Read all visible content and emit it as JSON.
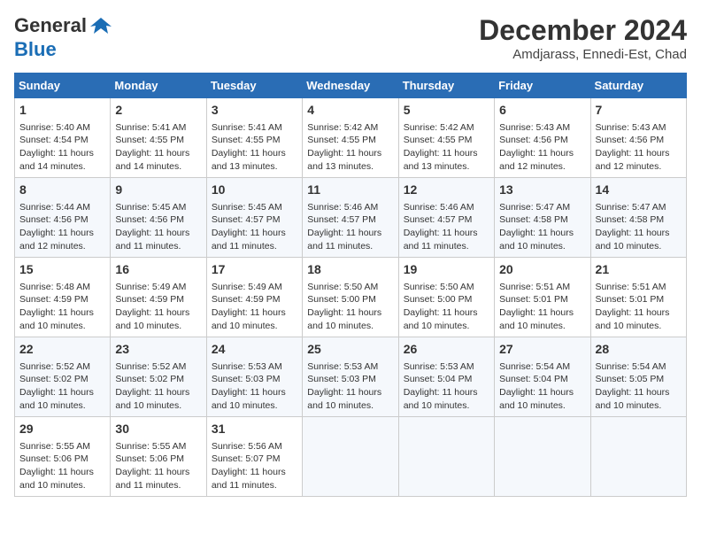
{
  "header": {
    "logo_general": "General",
    "logo_blue": "Blue",
    "month_year": "December 2024",
    "location": "Amdjarass, Ennedi-Est, Chad"
  },
  "days_of_week": [
    "Sunday",
    "Monday",
    "Tuesday",
    "Wednesday",
    "Thursday",
    "Friday",
    "Saturday"
  ],
  "weeks": [
    [
      {
        "day": 1,
        "sunrise": "5:40 AM",
        "sunset": "4:54 PM",
        "daylight": "11 hours and 14 minutes."
      },
      {
        "day": 2,
        "sunrise": "5:41 AM",
        "sunset": "4:55 PM",
        "daylight": "11 hours and 14 minutes."
      },
      {
        "day": 3,
        "sunrise": "5:41 AM",
        "sunset": "4:55 PM",
        "daylight": "11 hours and 13 minutes."
      },
      {
        "day": 4,
        "sunrise": "5:42 AM",
        "sunset": "4:55 PM",
        "daylight": "11 hours and 13 minutes."
      },
      {
        "day": 5,
        "sunrise": "5:42 AM",
        "sunset": "4:55 PM",
        "daylight": "11 hours and 13 minutes."
      },
      {
        "day": 6,
        "sunrise": "5:43 AM",
        "sunset": "4:56 PM",
        "daylight": "11 hours and 12 minutes."
      },
      {
        "day": 7,
        "sunrise": "5:43 AM",
        "sunset": "4:56 PM",
        "daylight": "11 hours and 12 minutes."
      }
    ],
    [
      {
        "day": 8,
        "sunrise": "5:44 AM",
        "sunset": "4:56 PM",
        "daylight": "11 hours and 12 minutes."
      },
      {
        "day": 9,
        "sunrise": "5:45 AM",
        "sunset": "4:56 PM",
        "daylight": "11 hours and 11 minutes."
      },
      {
        "day": 10,
        "sunrise": "5:45 AM",
        "sunset": "4:57 PM",
        "daylight": "11 hours and 11 minutes."
      },
      {
        "day": 11,
        "sunrise": "5:46 AM",
        "sunset": "4:57 PM",
        "daylight": "11 hours and 11 minutes."
      },
      {
        "day": 12,
        "sunrise": "5:46 AM",
        "sunset": "4:57 PM",
        "daylight": "11 hours and 11 minutes."
      },
      {
        "day": 13,
        "sunrise": "5:47 AM",
        "sunset": "4:58 PM",
        "daylight": "11 hours and 10 minutes."
      },
      {
        "day": 14,
        "sunrise": "5:47 AM",
        "sunset": "4:58 PM",
        "daylight": "11 hours and 10 minutes."
      }
    ],
    [
      {
        "day": 15,
        "sunrise": "5:48 AM",
        "sunset": "4:59 PM",
        "daylight": "11 hours and 10 minutes."
      },
      {
        "day": 16,
        "sunrise": "5:49 AM",
        "sunset": "4:59 PM",
        "daylight": "11 hours and 10 minutes."
      },
      {
        "day": 17,
        "sunrise": "5:49 AM",
        "sunset": "4:59 PM",
        "daylight": "11 hours and 10 minutes."
      },
      {
        "day": 18,
        "sunrise": "5:50 AM",
        "sunset": "5:00 PM",
        "daylight": "11 hours and 10 minutes."
      },
      {
        "day": 19,
        "sunrise": "5:50 AM",
        "sunset": "5:00 PM",
        "daylight": "11 hours and 10 minutes."
      },
      {
        "day": 20,
        "sunrise": "5:51 AM",
        "sunset": "5:01 PM",
        "daylight": "11 hours and 10 minutes."
      },
      {
        "day": 21,
        "sunrise": "5:51 AM",
        "sunset": "5:01 PM",
        "daylight": "11 hours and 10 minutes."
      }
    ],
    [
      {
        "day": 22,
        "sunrise": "5:52 AM",
        "sunset": "5:02 PM",
        "daylight": "11 hours and 10 minutes."
      },
      {
        "day": 23,
        "sunrise": "5:52 AM",
        "sunset": "5:02 PM",
        "daylight": "11 hours and 10 minutes."
      },
      {
        "day": 24,
        "sunrise": "5:53 AM",
        "sunset": "5:03 PM",
        "daylight": "11 hours and 10 minutes."
      },
      {
        "day": 25,
        "sunrise": "5:53 AM",
        "sunset": "5:03 PM",
        "daylight": "11 hours and 10 minutes."
      },
      {
        "day": 26,
        "sunrise": "5:53 AM",
        "sunset": "5:04 PM",
        "daylight": "11 hours and 10 minutes."
      },
      {
        "day": 27,
        "sunrise": "5:54 AM",
        "sunset": "5:04 PM",
        "daylight": "11 hours and 10 minutes."
      },
      {
        "day": 28,
        "sunrise": "5:54 AM",
        "sunset": "5:05 PM",
        "daylight": "11 hours and 10 minutes."
      }
    ],
    [
      {
        "day": 29,
        "sunrise": "5:55 AM",
        "sunset": "5:06 PM",
        "daylight": "11 hours and 10 minutes."
      },
      {
        "day": 30,
        "sunrise": "5:55 AM",
        "sunset": "5:06 PM",
        "daylight": "11 hours and 11 minutes."
      },
      {
        "day": 31,
        "sunrise": "5:56 AM",
        "sunset": "5:07 PM",
        "daylight": "11 hours and 11 minutes."
      },
      null,
      null,
      null,
      null
    ]
  ],
  "labels": {
    "sunrise": "Sunrise:",
    "sunset": "Sunset:",
    "daylight": "Daylight:"
  }
}
